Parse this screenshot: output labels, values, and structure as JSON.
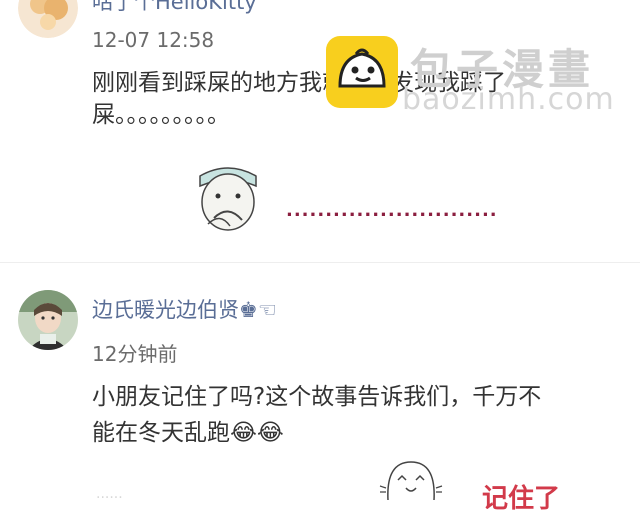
{
  "comments": [
    {
      "name": "咕了个HelloKitty",
      "time": "12-07 12:58",
      "content_line1": "刚刚看到踩屎的地方我就忽然发现我踩了",
      "content_line2": "屎。。。。。。。。。"
    },
    {
      "name": "边氏暖光边伯贤♚☜",
      "time": "12分钟前",
      "content_line1": "小朋友记住了吗?这个故事告诉我们，千万不",
      "content_line2": "能在冬天乱跑😂😂"
    }
  ],
  "meme_dots": "...........................",
  "watermark": {
    "title": "包子漫畫",
    "url": "baozimh.com"
  },
  "bottom_partial": {
    "red_text": "记住了",
    "gray_text": "......"
  }
}
